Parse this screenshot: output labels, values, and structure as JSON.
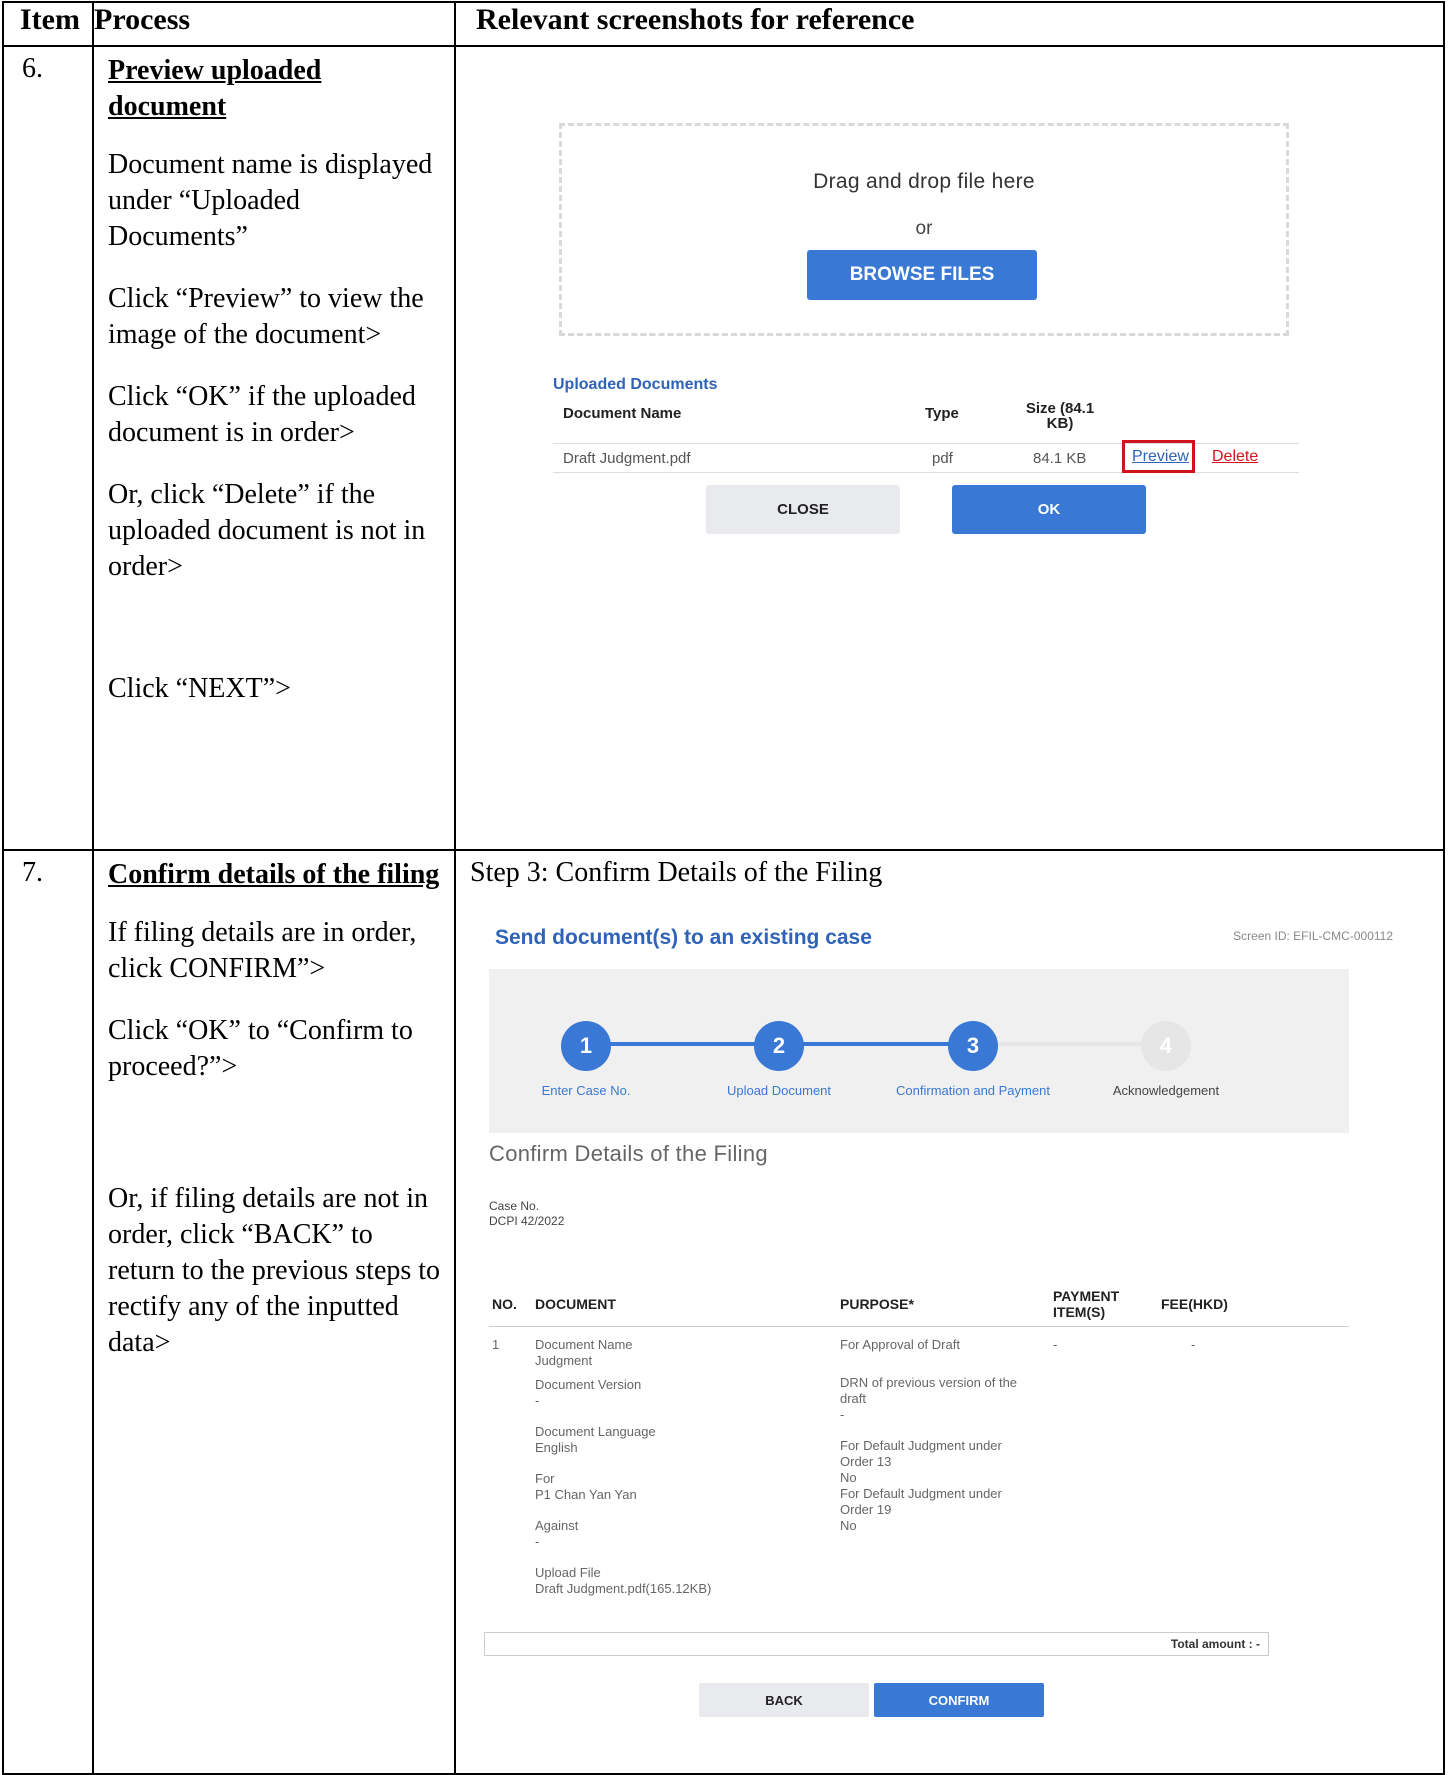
{
  "header": {
    "item": "Item",
    "process": "Process",
    "screenshots": "Relevant screenshots for reference"
  },
  "row6": {
    "no": "6.",
    "title": "Preview uploaded document",
    "p1": "Document name is displayed under “Uploaded Documents”",
    "p2": "Click “Preview” to view the image of the document>",
    "p3": "Click “OK” if the uploaded document is in order>",
    "p4": "Or, click “Delete” if the uploaded document is not in order>",
    "p5": "Click “NEXT”>"
  },
  "shot1": {
    "drag_text": "Drag and drop file here",
    "or_text": "or",
    "browse_label": "BROWSE FILES",
    "uploaded_title": "Uploaded Documents",
    "col_name": "Document Name",
    "col_type": "Type",
    "col_size": "Size (84.1 KB)",
    "file_name": "Draft Judgment.pdf",
    "file_type": "pdf",
    "file_size": "84.1 KB",
    "preview_label": "Preview",
    "delete_label": "Delete",
    "close_label": "CLOSE",
    "ok_label": "OK",
    "link_color": "#2e63b7",
    "delete_color": "#d0141c"
  },
  "row7": {
    "no": "7.",
    "title": "Confirm details of the filing",
    "p1": "If filing details are in order, click CONFIRM”>",
    "p2": "Click “OK” to “Confirm to proceed?”>",
    "p3": "Or, if filing details are not in order, click “BACK” to return to the previous steps to rectify any of the inputted data>"
  },
  "shot2": {
    "caption": "Step 3: Confirm Details of the Filing",
    "title": "Send document(s) to an existing case",
    "screen_id": "Screen ID: EFIL-CMC-000112",
    "steps": [
      {
        "num": "1",
        "label": "Enter Case No."
      },
      {
        "num": "2",
        "label": "Upload Document"
      },
      {
        "num": "3",
        "label": "Confirmation and Payment"
      },
      {
        "num": "4",
        "label": "Acknowledgement"
      }
    ],
    "subtitle": "Confirm Details of the Filing",
    "case_label": "Case No.",
    "case_value": "DCPI 42/2022",
    "th_no": "NO.",
    "th_doc": "DOCUMENT",
    "th_purpose": "PURPOSE*",
    "th_payment": "PAYMENT ITEM(S)",
    "th_fee": "FEE(HKD)",
    "row_no": "1",
    "doc_name_label": "Document Name",
    "doc_name_value": "Judgment",
    "doc_version_label": "Document Version",
    "doc_version_value": "-",
    "doc_lang_label": "Document Language",
    "doc_lang_value": "English",
    "for_label": "For",
    "for_value": "P1 Chan Yan Yan",
    "against_label": "Against",
    "against_value": "-",
    "upload_label": "Upload File",
    "upload_value": "Draft Judgment.pdf(165.12KB)",
    "purpose_value": "For Approval of Draft",
    "drn_label": "DRN of previous version of the draft",
    "drn_value": "-",
    "o13_label": "For Default Judgment under Order 13",
    "o13_value": "No",
    "o19_label": "For Default Judgment under Order 19",
    "o19_value": "No",
    "payment_value": "-",
    "fee_value": "-",
    "total_label": "Total amount : -",
    "back_label": "BACK",
    "confirm_label": "CONFIRM",
    "active_color": "#3a78d6",
    "inactive_color": "#e6e6e6"
  }
}
